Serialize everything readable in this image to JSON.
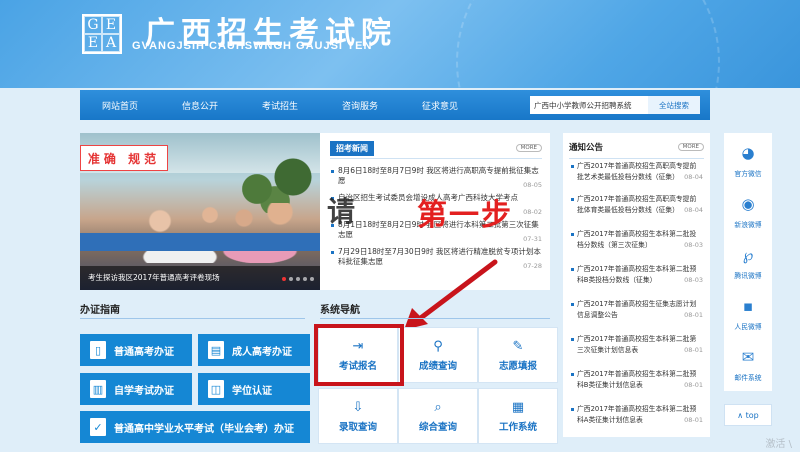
{
  "header": {
    "logo_letters": [
      "G",
      "E",
      "E",
      "A"
    ],
    "title": "广西招生考试院",
    "subtitle": "GVANGJSIH CAUHSWNGH GAUJSI YEN"
  },
  "nav": {
    "items": [
      "网站首页",
      "信息公开",
      "考试招生",
      "咨询服务",
      "征求意见"
    ],
    "search_value": "广西中小学教师公开招聘系统",
    "search_button": "全站搜索"
  },
  "slideshow": {
    "banner_text": "准确 规范",
    "caption": "考生探访我区2017年普通高考评卷现场"
  },
  "news": {
    "title": "招考新闻",
    "more": "MORE",
    "items": [
      {
        "text": "8月6日18时至8月7日9时 我区将进行高职高专提前批征集志愿",
        "date": "08-05"
      },
      {
        "text": "自治区招生考试委员会增设成人高考广西科技大学考点",
        "date": "08-02"
      },
      {
        "text": "8月1日18时至8月2日9时 我区将进行本科第二批第三次征集志愿",
        "date": "07-31"
      },
      {
        "text": "7月29日18时至7月30日9时 我区将进行精准脱贫专项计划本科批征集志愿",
        "date": "07-28"
      }
    ]
  },
  "overlay": {
    "qing": "请",
    "step": "第一步"
  },
  "guide": {
    "title": "办证指南",
    "buttons": [
      {
        "label": "普通高考办证",
        "icon": "document-icon",
        "glyph": "▯"
      },
      {
        "label": "成人高考办证",
        "icon": "book-icon",
        "glyph": "▤"
      },
      {
        "label": "自学考试办证",
        "icon": "chart-icon",
        "glyph": "▥"
      },
      {
        "label": "学位认证",
        "icon": "certificate-icon",
        "glyph": "◫"
      },
      {
        "label": "普通高中学业水平考试（毕业会考）办证",
        "icon": "document-check-icon",
        "glyph": "✓"
      }
    ]
  },
  "system_nav": {
    "title": "系统导航",
    "buttons": [
      {
        "label": "考试报名",
        "icon": "login-arrow-icon",
        "glyph": "⇥"
      },
      {
        "label": "成绩查询",
        "icon": "search-icon",
        "glyph": "⚲"
      },
      {
        "label": "志愿填报",
        "icon": "pencil-icon",
        "glyph": "✎"
      },
      {
        "label": "录取查询",
        "icon": "download-doc-icon",
        "glyph": "⇩"
      },
      {
        "label": "综合查询",
        "icon": "magnify-doc-icon",
        "glyph": "⌕"
      },
      {
        "label": "工作系统",
        "icon": "grid-doc-icon",
        "glyph": "▦"
      }
    ]
  },
  "notice": {
    "title": "通知公告",
    "more": "MORE",
    "items": [
      {
        "text": "广西2017年普通高校招生高职高专提前批艺术类最低投档分数线（征集）",
        "date": "08-04"
      },
      {
        "text": "广西2017年普通高校招生高职高专提前批体育类最低投档分数线（征集）",
        "date": "08-04"
      },
      {
        "text": "广西2017年普通高校招生本科第二批投档分数线（第三次征集）",
        "date": "08-03"
      },
      {
        "text": "广西2017年普通高校招生本科第二批预科B类投档分数线（征集）",
        "date": "08-03"
      },
      {
        "text": "广西2017年普通高校招生征集志愿计划信息调整公告",
        "date": "08-01"
      },
      {
        "text": "广西2017年普通高校招生本科第二批第三次征集计划信息表",
        "date": "08-01"
      },
      {
        "text": "广西2017年普通高校招生本科第二批预科B类征集计划信息表",
        "date": "08-01"
      },
      {
        "text": "广西2017年普通高校招生本科第二批预科A类征集计划信息表",
        "date": "08-01"
      }
    ]
  },
  "social": {
    "items": [
      {
        "label": "官方微信",
        "icon": "wechat-icon",
        "glyph": "◕"
      },
      {
        "label": "新浪微博",
        "icon": "weibo-icon",
        "glyph": "◉"
      },
      {
        "label": "腾讯微博",
        "icon": "tencent-weibo-icon",
        "glyph": "℘"
      },
      {
        "label": "人民微博",
        "icon": "people-weibo-icon",
        "glyph": "▪"
      },
      {
        "label": "邮件系统",
        "icon": "mail-icon",
        "glyph": "✉"
      }
    ],
    "top": "∧ top"
  },
  "watermark": "激活 \\",
  "colors": {
    "primary": "#1587d4",
    "nav": "#1877c8",
    "highlight_box": "#c8141b",
    "overlay_step": "#e32020"
  }
}
